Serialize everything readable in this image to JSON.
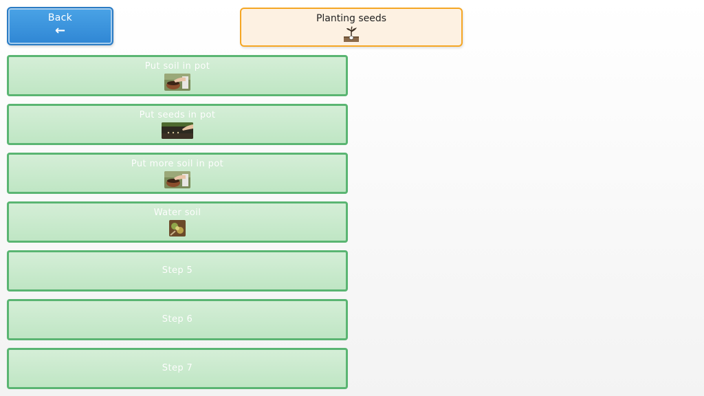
{
  "header": {
    "back_label": "Back",
    "back_icon": "arrow-left-icon",
    "title": "Planting seeds",
    "title_icon": "seedling-pot-icon"
  },
  "steps": [
    {
      "label": "Put soil in pot",
      "icon": "hand-soil-pot-photo"
    },
    {
      "label": "Put seeds in pot",
      "icon": "seeds-in-soil-photo"
    },
    {
      "label": "Put more soil in pot",
      "icon": "hand-soil-pot-photo"
    },
    {
      "label": "Water soil",
      "icon": "watering-soil-photo"
    },
    {
      "label": "Step 5"
    },
    {
      "label": "Step 6"
    },
    {
      "label": "Step 7"
    }
  ],
  "colors": {
    "back_button": "#3a93dc",
    "title_border": "#f5a623",
    "title_fill": "#fdf1e2",
    "step_border": "#5ab572",
    "step_fill": "#c8eacb"
  }
}
